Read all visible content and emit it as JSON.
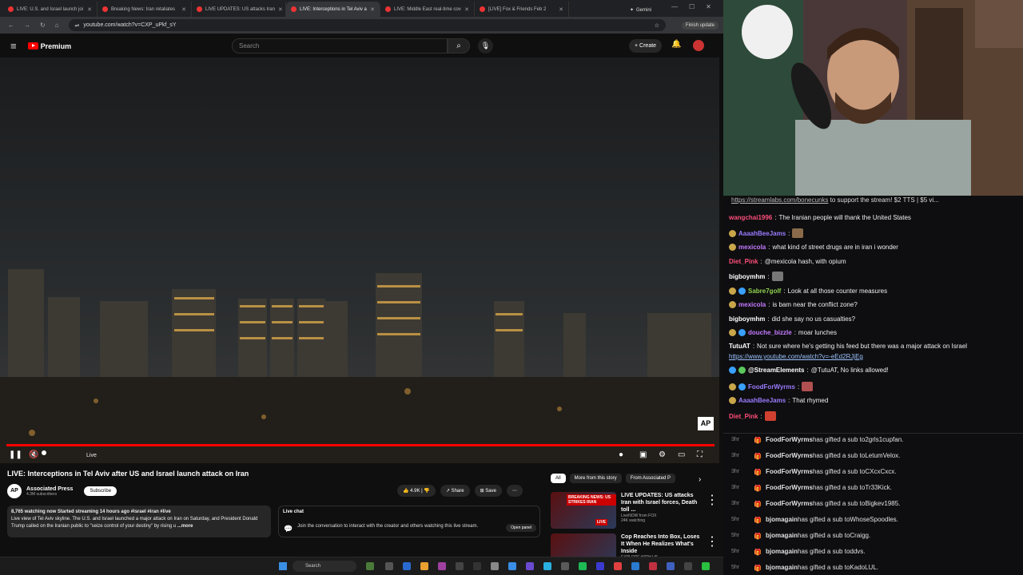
{
  "browser": {
    "tabs": [
      {
        "title": "LIVE: U.S. and Israel launch joi",
        "active": false
      },
      {
        "title": "Breaking News: Iran retaliates",
        "active": false
      },
      {
        "title": "LIVE UPDATES: US attacks Iran",
        "active": false
      },
      {
        "title": "LIVE: Interceptions in Tel Aviv a",
        "active": true
      },
      {
        "title": "LIVE: Middle East real-time cov",
        "active": false
      },
      {
        "title": "[LIVE] Fox & Friends Feb 2",
        "active": false
      }
    ],
    "gemini_label": "Gemini",
    "url": "youtube.com/watch?v=CXP_uPkf_sY",
    "finish_update_label": "Finish update"
  },
  "youtube": {
    "logo_text": "Premium",
    "search_placeholder": "Search",
    "create_label": "Create",
    "video": {
      "live_label": "Live",
      "watermark": "AP",
      "title": "LIVE: Interceptions in Tel Aviv after US and Israel launch attack on Iran",
      "channel": "Associated Press",
      "subscribers": "4.3M subscribers",
      "subscribe_label": "Subscribe",
      "likes": "4.9K",
      "share_label": "Share",
      "save_label": "Save",
      "meta": "8,765 watching now  Started streaming 14 hours ago  #israel #iran #live",
      "description": "Live view of Tel Aviv skyline. The U.S. and Israel launched a major attack on Iran on Saturday, and President Donald Trump called on the Iranian public to \"seize control of your destiny\" by rising u",
      "more_label": "...more"
    },
    "livechat": {
      "title": "Live chat",
      "text": "Join the conversation to interact with the creator and others watching this live stream.",
      "open_panel": "Open panel"
    },
    "chips": [
      "All",
      "More from this story",
      "From Associated P"
    ],
    "recommendations": [
      {
        "banner": "BREAKING NEWS: US STRIKES IRAN",
        "title": "LIVE UPDATES: US attacks Iran with Israel forces, Death toll ...",
        "channel": "LiveNOW from FOX",
        "stats": "24K watching",
        "badge": "LIVE"
      },
      {
        "title": "Cop Reaches Into Box, Loses It When He Realizes What's Inside",
        "channel": "EXPLORE WITH US",
        "stats": ""
      }
    ]
  },
  "taskbar": {
    "search_label": "Search"
  },
  "stream": {
    "banner_link": "https://streamlabs.com/bonecunks",
    "banner_text": " to support the stream! $2 TTS | $5 vi...",
    "chat": [
      {
        "user": "wangchai1996",
        "color": "#ff4e7a",
        "text": "The Iranian people will thank the United States",
        "badges": []
      },
      {
        "user": "AaaahBeeJams",
        "color": "#9b7bff",
        "text": "",
        "badges": [
          "#c9a64a"
        ],
        "emote": "#8a6a4a"
      },
      {
        "user": "mexicola",
        "color": "#c57bff",
        "text": "what kind of street drugs are in iran i wonder",
        "badges": [
          "#c9a64a"
        ]
      },
      {
        "user": "Diet_Pink",
        "color": "#ff4e7a",
        "text": "@mexicola hash, with opium",
        "badges": []
      },
      {
        "user": "bigboymhm",
        "color": "#ffffff",
        "text": "",
        "badges": [],
        "emote": "#777"
      },
      {
        "user": "Sabre7golf",
        "color": "#8fd14f",
        "text": "Look at all those counter measures",
        "badges": [
          "#c9a64a",
          "#3aa0ff"
        ]
      },
      {
        "user": "mexicola",
        "color": "#c57bff",
        "text": "is bam near the conflict zone?",
        "badges": [
          "#c9a64a"
        ]
      },
      {
        "user": "bigboymhm",
        "color": "#ffffff",
        "text": "did she say no us casualties?",
        "badges": []
      },
      {
        "user": "douche_bizzle",
        "color": "#c57bff",
        "text": "moar lunches",
        "badges": [
          "#c9a64a",
          "#3aa0ff"
        ]
      },
      {
        "user": "TutuAT",
        "color": "#ffffff",
        "text": "Not sure where he's getting his feed but there was a major attack on Israel",
        "badges": []
      },
      {
        "user": "",
        "color": "#ffffff",
        "text": "",
        "link": "https://www.youtube.com/watch?v=-eEd2RJjEg",
        "badges": []
      },
      {
        "user": "@StreamElements",
        "color": "#ffffff",
        "text": "@TutuAT, No links allowed!",
        "badges": [
          "#3aa0ff",
          "#5ac85a"
        ]
      },
      {
        "user": "FoodForWyrms",
        "color": "#9b7bff",
        "text": "",
        "badges": [
          "#c9a64a",
          "#3aa0ff"
        ],
        "emote": "#b05050"
      },
      {
        "user": "AaaahBeeJams",
        "color": "#9b7bff",
        "text": "That rhymed",
        "badges": [
          "#c9a64a"
        ]
      },
      {
        "user": "Diet_Pink",
        "color": "#ff4e7a",
        "text": "",
        "badges": [],
        "emote": "#d04030"
      }
    ],
    "subs": [
      {
        "time": "3hr",
        "gifter": "FoodForWyrms",
        "text": " has gifted a sub to ",
        "to": "2grls1cupfan."
      },
      {
        "time": "3hr",
        "gifter": "FoodForWyrms",
        "text": " has gifted a sub to ",
        "to": "LetumVelox."
      },
      {
        "time": "3hr",
        "gifter": "FoodForWyrms",
        "text": " has gifted a sub to ",
        "to": "CXcxCxcx."
      },
      {
        "time": "3hr",
        "gifter": "FoodForWyrms",
        "text": " has gifted a sub to ",
        "to": "Tr33Kick."
      },
      {
        "time": "3hr",
        "gifter": "FoodForWyrms",
        "text": " has gifted a sub to ",
        "to": "Bigkev1985."
      },
      {
        "time": "5hr",
        "gifter": "bjomagain",
        "text": " has gifted a sub to ",
        "to": "WhoseSpoodles."
      },
      {
        "time": "5hr",
        "gifter": "bjomagain",
        "text": " has gifted a sub to ",
        "to": "Craigg."
      },
      {
        "time": "5hr",
        "gifter": "bjomagain",
        "text": " has gifted a sub to ",
        "to": "ddvs."
      },
      {
        "time": "5hr",
        "gifter": "bjomagain",
        "text": " has gifted a sub to ",
        "to": "KadoLUL."
      }
    ]
  }
}
